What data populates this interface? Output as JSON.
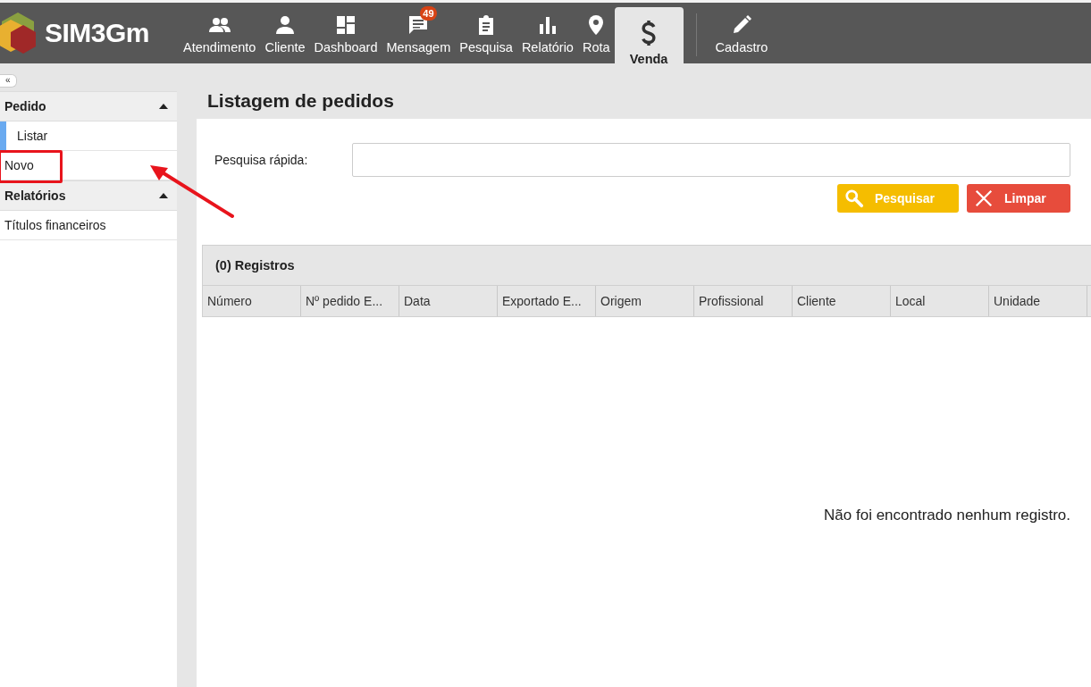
{
  "header": {
    "logo": "SIM3Gm",
    "nav": [
      {
        "label": "Atendimento",
        "kind": "people",
        "selected": false
      },
      {
        "label": "Cliente",
        "kind": "person",
        "selected": false
      },
      {
        "label": "Dashboard",
        "kind": "dashboard",
        "selected": false
      },
      {
        "label": "Mensagem",
        "kind": "chat",
        "selected": false,
        "badge": "49"
      },
      {
        "label": "Pesquisa",
        "kind": "clipboard",
        "selected": false
      },
      {
        "label": "Relatório",
        "kind": "bars",
        "selected": false
      },
      {
        "label": "Rota",
        "kind": "pin",
        "selected": false
      },
      {
        "label": "Venda",
        "kind": "dollar",
        "selected": true
      },
      {
        "label": "Cadastro",
        "kind": "pencil",
        "selected": false
      }
    ]
  },
  "sidebar": {
    "collapse": "«",
    "sections": [
      {
        "title": "Pedido",
        "expanded": true,
        "items": [
          {
            "label": "Listar",
            "selected": true,
            "highlighted": false
          },
          {
            "label": "Novo",
            "selected": false,
            "highlighted": true
          }
        ]
      },
      {
        "title": "Relatórios",
        "expanded": true,
        "items": [
          {
            "label": "Títulos financeiros",
            "selected": false,
            "highlighted": false
          }
        ]
      }
    ]
  },
  "page": {
    "title": "Listagem de pedidos",
    "search": {
      "label": "Pesquisa rápida:"
    },
    "buttons": [
      {
        "label": "Pesquisar",
        "kind": "search"
      },
      {
        "label": "Limpar",
        "kind": "clear"
      }
    ],
    "table": {
      "title": "(0) Registros",
      "columns": [
        "Número",
        "Nº pedido E...",
        "Data",
        "Exportado E...",
        "Origem",
        "Profissional",
        "Cliente",
        "Local",
        "Unidade"
      ],
      "empty_message": "Não foi encontrado nenhum registro."
    }
  }
}
